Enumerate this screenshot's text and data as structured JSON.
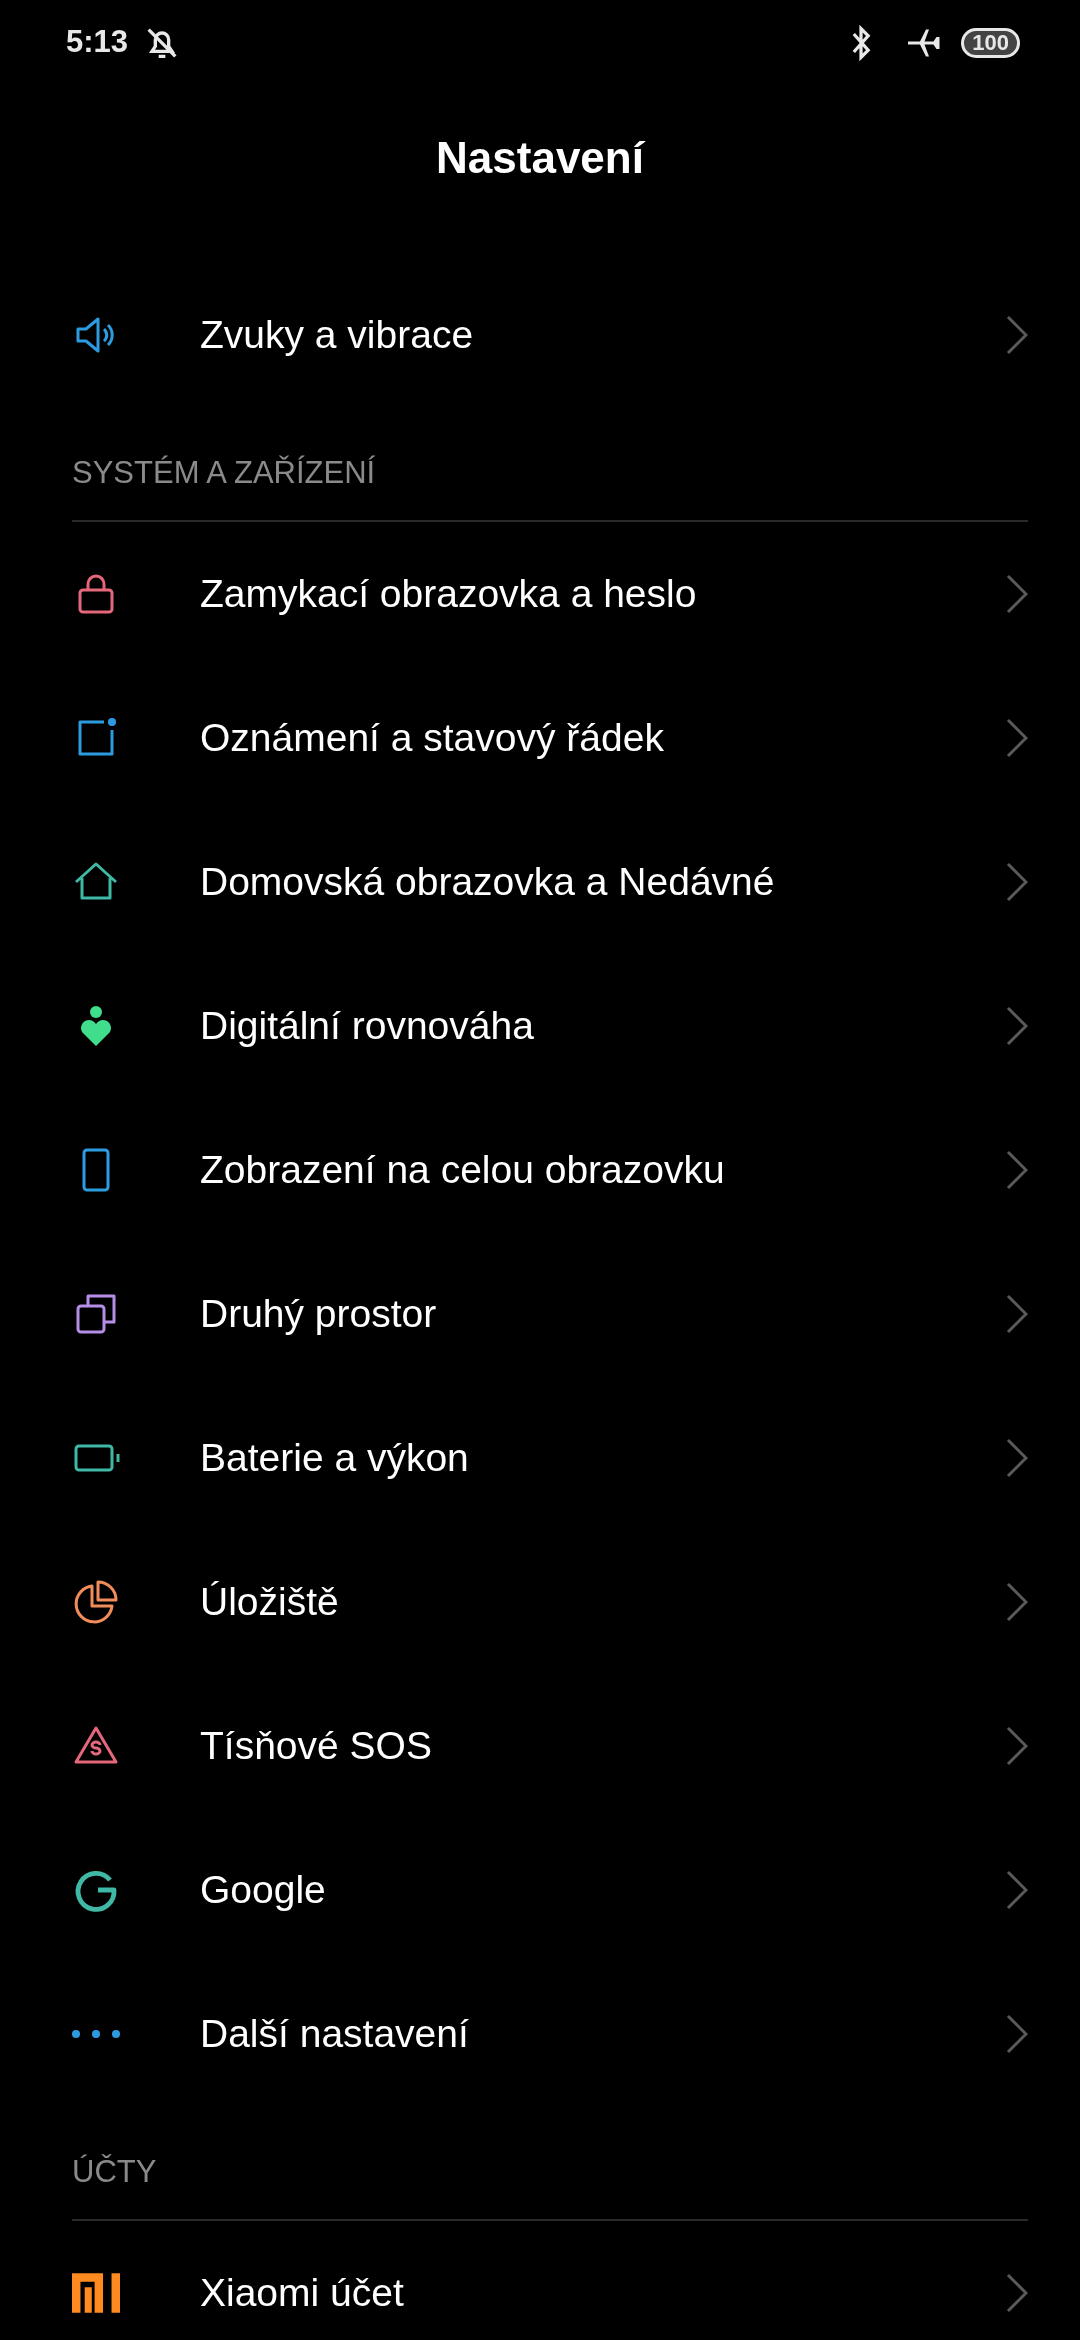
{
  "status_bar": {
    "time": "5:13",
    "battery": "100"
  },
  "title": "Nastavení",
  "sections": [
    {
      "items": [
        {
          "label": "Zvuky a vibrace",
          "color": "#2d9be0"
        }
      ]
    },
    {
      "header": "SYSTÉM A ZAŘÍZENÍ",
      "items": [
        {
          "label": "Zamykací obrazovka a heslo",
          "color": "#e5677a"
        },
        {
          "label": "Oznámení a stavový řádek",
          "color": "#2d9be0"
        },
        {
          "label": "Domovská obrazovka a Nedávné",
          "color": "#3fb8a5"
        },
        {
          "label": "Digitální rovnováha",
          "color": "#40de8c"
        },
        {
          "label": "Zobrazení na celou obrazovku",
          "color": "#2d9be0"
        },
        {
          "label": "Druhý prostor",
          "color": "#b58ee8"
        },
        {
          "label": "Baterie a výkon",
          "color": "#3fb8a5"
        },
        {
          "label": "Úložiště",
          "color": "#f08d5a"
        },
        {
          "label": "Tísňové SOS",
          "color": "#e5677a"
        },
        {
          "label": "Google",
          "color": "#3fb8a5"
        },
        {
          "label": "Další nastavení",
          "color": "#2d9be0"
        }
      ]
    },
    {
      "header": "ÚČTY",
      "items": [
        {
          "label": "Xiaomi účet",
          "color": "#ff8a1f"
        }
      ]
    }
  ]
}
